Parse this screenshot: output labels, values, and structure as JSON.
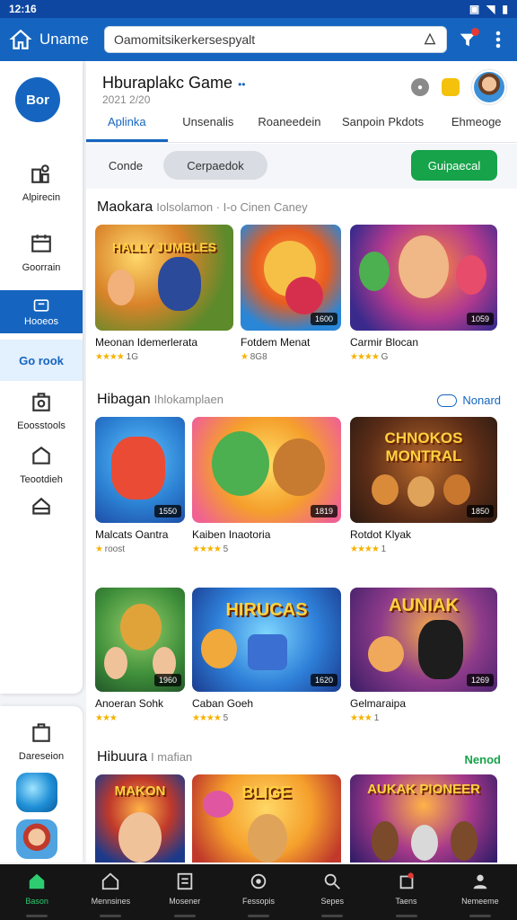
{
  "status_bar": {
    "time": "12:16"
  },
  "app_bar": {
    "title": "Uname",
    "search_value": "Oamomitsikerkersespyalt",
    "search_placeholder": "Search"
  },
  "sidebar": {
    "logo": "Bor",
    "items": [
      {
        "label": "Alpirecin",
        "icon": "store-icon"
      },
      {
        "label": "Goorrain",
        "icon": "calendar-icon"
      },
      {
        "label": "Hooeos",
        "icon": "games-icon",
        "active": true
      },
      {
        "label": "Go rook",
        "icon": "brand-e-icon"
      },
      {
        "label": "Eoosstools",
        "icon": "bag-icon"
      },
      {
        "label": "Teootdieh",
        "icon": "house-icon"
      },
      {
        "label": "",
        "icon": "shield-icon"
      }
    ],
    "bottom_item": {
      "label": "Dareseion",
      "icon": "bag-icon"
    }
  },
  "header": {
    "title": "Hburaplakc Game",
    "subtitle": "2021 2/20",
    "tabs": [
      "Aplinka",
      "Unsenalis",
      "Roaneedein",
      "Sanpoin Pkdots",
      "Ehmeoge"
    ],
    "active_tab": 0
  },
  "filters": {
    "chip_plain": "Conde",
    "chip_selected": "Cerpaedok",
    "go_button": "Guipaecal"
  },
  "sections": [
    {
      "title": "Maokara",
      "subtitle": "Iolsolamon · I-o Cinen Caney",
      "more": "",
      "games": [
        {
          "name": "Meonan Idemerlerata",
          "rating": "★★★★",
          "meta": "1G",
          "tag": ""
        },
        {
          "name": "Fotdem Menat",
          "rating": "★",
          "meta": "8G8",
          "tag": "1600"
        },
        {
          "name": "Carmir Blocan",
          "rating": "★★★★",
          "meta": "G",
          "tag": "1059"
        }
      ]
    },
    {
      "title": "Hibagan",
      "subtitle": "Ihlokamplaen",
      "more": "Nonard",
      "games": [
        {
          "name": "Malcats Oantra",
          "rating": "★",
          "meta": "roost",
          "tag": "1550"
        },
        {
          "name": "Kaiben Inaotoria",
          "rating": "★★★★",
          "meta": "5",
          "tag": "1819"
        },
        {
          "name": "Rotdot Klyak",
          "rating": "★★★★",
          "meta": "1",
          "tag": "1850"
        }
      ]
    },
    {
      "title": "",
      "subtitle": "",
      "more": "",
      "games": [
        {
          "name": "Anoeran Sohk",
          "rating": "★★★",
          "meta": "",
          "tag": "1960"
        },
        {
          "name": "Caban Goeh",
          "rating": "★★★★",
          "meta": "5",
          "tag": "1620"
        },
        {
          "name": "Gelmaraipa",
          "rating": "★★★",
          "meta": "1",
          "tag": "1269"
        }
      ]
    },
    {
      "title": "Hibuura",
      "subtitle": "I mafian",
      "more": "Nenod",
      "games": [
        {
          "name": "",
          "rating": "",
          "meta": "",
          "tag": ""
        },
        {
          "name": "",
          "rating": "",
          "meta": "",
          "tag": ""
        },
        {
          "name": "",
          "rating": "",
          "meta": "",
          "tag": ""
        }
      ]
    }
  ],
  "thumb_text": [
    "HALLY JUMBLES",
    "CHNOKOS MONTRAL",
    "HIRUCAS",
    "AUNIAK",
    "MAKON",
    "BLIGE",
    "AUKAK PIONEER"
  ],
  "bottom_nav": [
    {
      "label": "Bason",
      "icon": "home-icon",
      "active": true
    },
    {
      "label": "Mennsines",
      "icon": "house-outline-icon"
    },
    {
      "label": "Mosener",
      "icon": "list-icon"
    },
    {
      "label": "Fessopis",
      "icon": "refresh-icon"
    },
    {
      "label": "Sepes",
      "icon": "search-icon"
    },
    {
      "label": "Taens",
      "icon": "notification-icon"
    },
    {
      "label": "Nemeeme",
      "icon": "profile-icon"
    }
  ],
  "colors": {
    "primary": "#1565c0",
    "accent_green": "#16a34a",
    "bottom_nav_bg": "#151515",
    "star": "#f5b301"
  }
}
